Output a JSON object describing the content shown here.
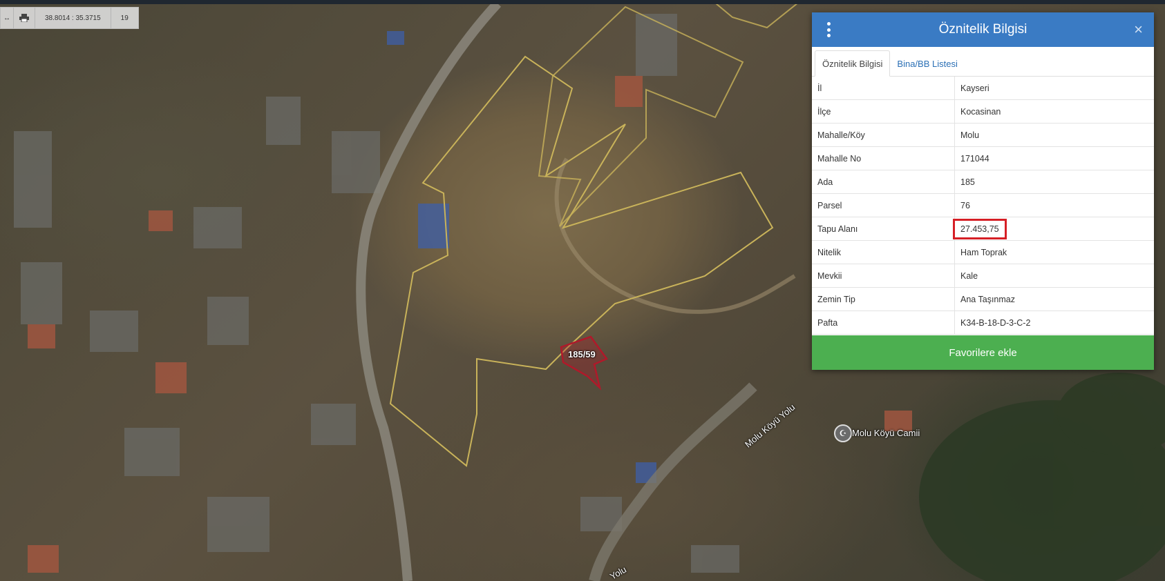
{
  "toolbar": {
    "coordinates": "38.8014 : 35.3715",
    "zoom": "19"
  },
  "map": {
    "parcel_label": "185/59",
    "poi_name": "Molu Köyü Camii",
    "road_name_1": "Molu Köyü Yolu",
    "road_name_2": "Yolu"
  },
  "panel": {
    "title": "Öznitelik Bilgisi",
    "tabs": [
      "Öznitelik Bilgisi",
      "Bina/BB Listesi"
    ],
    "rows": [
      {
        "key": "İl",
        "value": "Kayseri"
      },
      {
        "key": "İlçe",
        "value": "Kocasinan"
      },
      {
        "key": "Mahalle/Köy",
        "value": "Molu"
      },
      {
        "key": "Mahalle No",
        "value": "171044"
      },
      {
        "key": "Ada",
        "value": "185"
      },
      {
        "key": "Parsel",
        "value": "76"
      },
      {
        "key": "Tapu Alanı",
        "value": "27.453,75"
      },
      {
        "key": "Nitelik",
        "value": "Ham Toprak"
      },
      {
        "key": "Mevkii",
        "value": "Kale"
      },
      {
        "key": "Zemin Tip",
        "value": "Ana Taşınmaz"
      },
      {
        "key": "Pafta",
        "value": "K34-B-18-D-3-C-2"
      }
    ],
    "favorite_button": "Favorilere ekle"
  },
  "colors": {
    "header_blue": "#3a7bc4",
    "favorite_green": "#4caf50",
    "highlight_red": "#d61f26",
    "parcel_outline": "#c9b35a",
    "selected_parcel": "#b0192a"
  }
}
